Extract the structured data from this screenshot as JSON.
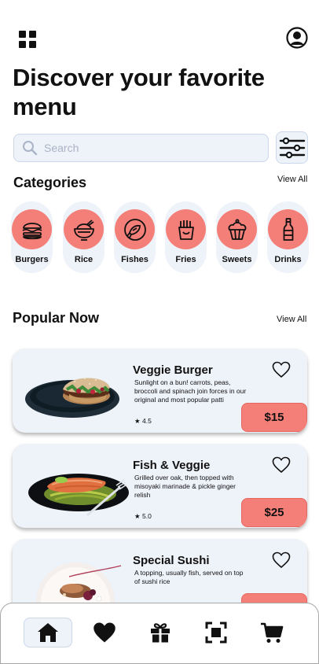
{
  "header": {
    "title": "Discover your favorite menu"
  },
  "search": {
    "placeholder": "Search"
  },
  "categories": {
    "title": "Categories",
    "view_all": "View All",
    "items": [
      {
        "label": "Burgers",
        "icon": "burger-icon"
      },
      {
        "label": "Rice",
        "icon": "rice-bowl-icon"
      },
      {
        "label": "Fishes",
        "icon": "fish-icon"
      },
      {
        "label": "Fries",
        "icon": "fries-icon"
      },
      {
        "label": "Sweets",
        "icon": "cupcake-icon"
      },
      {
        "label": "Drinks",
        "icon": "bottle-icon"
      }
    ]
  },
  "popular": {
    "title": "Popular Now",
    "view_all": "View All",
    "items": [
      {
        "name": "Veggie Burger",
        "description": "Sunlight on a bun! carrots, peas, broccoli and spinach join forces in our original and most popular patti",
        "rating": "★ 4.5",
        "price": "$15"
      },
      {
        "name": "Fish & Veggie",
        "description": "Grilled over oak, then topped with misoyaki marinade & pickle ginger relish",
        "rating": "★ 5.0",
        "price": "$25"
      },
      {
        "name": "Special Sushi",
        "description": "A topping, usually fish, served on top of sushi rice",
        "rating": "",
        "price": ""
      }
    ]
  },
  "nav": {
    "items": [
      {
        "icon": "home-icon",
        "active": true
      },
      {
        "icon": "heart-icon",
        "active": false
      },
      {
        "icon": "gift-icon",
        "active": false
      },
      {
        "icon": "scan-icon",
        "active": false
      },
      {
        "icon": "cart-icon",
        "active": false
      }
    ]
  },
  "colors": {
    "accent": "#f47f79",
    "surface": "#eef2f9",
    "border": "#cbd7ea"
  }
}
